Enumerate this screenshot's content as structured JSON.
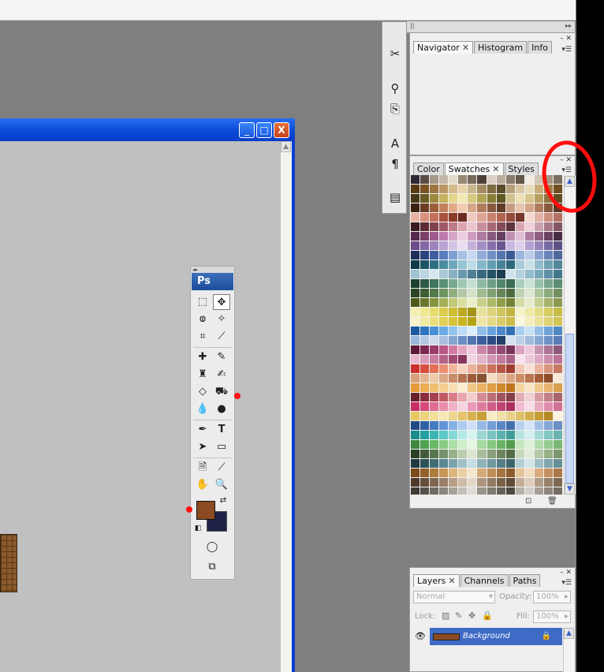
{
  "navigator_panel": {
    "tabs": [
      "Navigator",
      "Histogram",
      "Info"
    ]
  },
  "swatches_panel": {
    "tabs": [
      "Color",
      "Swatches",
      "Styles"
    ],
    "swatch_colors": [
      "#2e2832",
      "#5b4d46",
      "#a5998a",
      "#c3b9a8",
      "#e3dac8",
      "#9a8a75",
      "#786b5c",
      "#4e4238",
      "#dacfc2",
      "#bcae9d",
      "#8b7b6c",
      "#635849",
      "#f2ebe0",
      "#d0c4b2",
      "#a59684",
      "#7b6d5e",
      "#5a3a12",
      "#7a5424",
      "#9b7442",
      "#b99764",
      "#d4b98a",
      "#e8d2a8",
      "#cbb68c",
      "#a48c62",
      "#7e6a43",
      "#5b4c2c",
      "#b6a07a",
      "#d8c8a4",
      "#e9dcbd",
      "#c8ab78",
      "#9f7d49",
      "#704f21",
      "#433716",
      "#6a5a26",
      "#9c8a3f",
      "#c4b25d",
      "#e4d58a",
      "#f3e9b5",
      "#d7c97d",
      "#b1a453",
      "#887c36",
      "#5f5622",
      "#cfc18e",
      "#ebe0b6",
      "#d8c48d",
      "#b69e60",
      "#8d743d",
      "#614c22",
      "#3b2012",
      "#6b3d23",
      "#9c5e3a",
      "#c4825c",
      "#e1a984",
      "#f2cbb0",
      "#d6a487",
      "#b07a5c",
      "#875a40",
      "#5f3c28",
      "#c79b82",
      "#e6c4ad",
      "#d3a688",
      "#ae7c5d",
      "#86583d",
      "#5c3622",
      "#e8b3a3",
      "#d7907d",
      "#c46f5a",
      "#a9533f",
      "#8c3b2b",
      "#6d2a1f",
      "#f0c8be",
      "#dea293",
      "#c9806f",
      "#b26351",
      "#954a3a",
      "#77362a",
      "#f5d8cf",
      "#e3b2a5",
      "#cd8f80",
      "#b37062",
      "#3a1a1f",
      "#5d2b33",
      "#80414b",
      "#a05966",
      "#c07a86",
      "#dca3ad",
      "#eac5cb",
      "#c98e99",
      "#a66875",
      "#824a56",
      "#5f323c",
      "#d9a6b0",
      "#f0cfd6",
      "#caa1b0",
      "#a87a8b",
      "#845766",
      "#562a4a",
      "#7b3f6a",
      "#9e5a8c",
      "#bd7cac",
      "#d8a4c9",
      "#ecccdf",
      "#cf9dc0",
      "#ad7aa0",
      "#89597f",
      "#653f5e",
      "#c08fb1",
      "#dfbfd5",
      "#b07ea2",
      "#8e5e82",
      "#6b4262",
      "#4a2b44",
      "#6a4d8a",
      "#8367a5",
      "#9d84be",
      "#b9a3d3",
      "#d3c3e6",
      "#e7dcf2",
      "#c2b0db",
      "#a38fc5",
      "#8570ac",
      "#685591",
      "#c9b9e0",
      "#ddd0ec",
      "#b2a1d2",
      "#9585bb",
      "#776aa2",
      "#5c5287",
      "#1c2d5a",
      "#2b437e",
      "#3f5d9f",
      "#5a7cbd",
      "#7e9dd4",
      "#a8c0e6",
      "#c9d8f1",
      "#93abd9",
      "#7390c6",
      "#5574ae",
      "#3c5a92",
      "#9cb4de",
      "#bccdea",
      "#8aa1cf",
      "#6b84b7",
      "#4f689c",
      "#0f3a48",
      "#1c5466",
      "#2f6f84",
      "#4a8ca1",
      "#6da8bc",
      "#96c4d4",
      "#bcdbe6",
      "#84b7c9",
      "#639db1",
      "#468398",
      "#2c687d",
      "#a7cbd8",
      "#c8e0e8",
      "#90bccb",
      "#6fa1b3",
      "#528799",
      "#9ec3d3",
      "#b9d6e2",
      "#d5e7ee",
      "#a9c9d6",
      "#87b1c2",
      "#6899ad",
      "#4d8097",
      "#37687f",
      "#245266",
      "#1a3f50",
      "#cfe3eb",
      "#b3d2de",
      "#94bdcd",
      "#78a7ba",
      "#5d8fa4",
      "#43778c",
      "#1e4030",
      "#2d5a45",
      "#3f755c",
      "#589075",
      "#78ab91",
      "#9ec6b1",
      "#c3dfd1",
      "#8eb9a3",
      "#6d9f86",
      "#52866c",
      "#3a6d53",
      "#aacfbc",
      "#cbe3d6",
      "#98c1ab",
      "#79a78e",
      "#5c8d72",
      "#2a4424",
      "#3d5e34",
      "#53794a",
      "#6e9462",
      "#8fae80",
      "#b2c8a4",
      "#d2e2c7",
      "#a0bb91",
      "#819f72",
      "#668559",
      "#4c6b41",
      "#bed3b2",
      "#dbe8d2",
      "#abc59c",
      "#8dac7e",
      "#729264",
      "#4f5a1b",
      "#6a772a",
      "#86943c",
      "#a3b055",
      "#bfca77",
      "#d8e09f",
      "#eaefc7",
      "#c8d28a",
      "#abb865",
      "#909d49",
      "#758233",
      "#d3dba5",
      "#e6ebcb",
      "#c2ce8f",
      "#a5b46c",
      "#8a9a4f",
      "#f5f0b0",
      "#f0e88f",
      "#e8dc6c",
      "#ddcd4c",
      "#cfbd32",
      "#bba920",
      "#a39415",
      "#e9e29a",
      "#ddd37a",
      "#cfc45c",
      "#c1b442",
      "#f7f3c8",
      "#efe9a6",
      "#e4dc83",
      "#d6cc62",
      "#c7bc45",
      "#f9f3c9",
      "#f3eaa2",
      "#ebdf7c",
      "#e1d257",
      "#d6c437",
      "#c8b41f",
      "#b5a212",
      "#efe6a6",
      "#e5d985",
      "#d9cb66",
      "#ccbd4a",
      "#fbf8dc",
      "#f3edbc",
      "#e9e099",
      "#ded276",
      "#d2c455",
      "#1e5aa0",
      "#2d74bf",
      "#4690d6",
      "#68aae6",
      "#91c4f0",
      "#bddcf7",
      "#dbeefc",
      "#8dbde9",
      "#68a2dc",
      "#4a88ca",
      "#3170b3",
      "#a7cdef",
      "#c8e1f6",
      "#92bde7",
      "#70a2d6",
      "#5188c2",
      "#9bb6da",
      "#b4c8e4",
      "#cddaee",
      "#a8bfe0",
      "#86a5d1",
      "#6a8dc2",
      "#5075b1",
      "#3b5f9c",
      "#2c4c84",
      "#213d6c",
      "#d6e1f1",
      "#bdd0e9",
      "#a1bbde",
      "#87a6d2",
      "#6e91c5",
      "#577db7",
      "#5e1838",
      "#7e2650",
      "#9c3a69",
      "#b95684",
      "#d17aa2",
      "#e4a4c1",
      "#f2cadd",
      "#cb85a9",
      "#b0658d",
      "#944a73",
      "#7a345c",
      "#dca3c0",
      "#ecc7d9",
      "#c993b2",
      "#ac7497",
      "#8f597c",
      "#e6b6cc",
      "#d99ab6",
      "#ca7e9f",
      "#b86288",
      "#a24b72",
      "#89375d",
      "#f1d2e0",
      "#e3b4ca",
      "#d296b2",
      "#c07b9b",
      "#aa6285",
      "#f7e3ec",
      "#ebc7d7",
      "#dca9c2",
      "#cc8dac",
      "#ba7396",
      "#c9322e",
      "#d84f3e",
      "#e46f56",
      "#ed9174",
      "#f3b398",
      "#f8d3c0",
      "#ebb09a",
      "#dc8f79",
      "#cb705b",
      "#b75542",
      "#9f3e30",
      "#f4c7b4",
      "#fae1d6",
      "#eab39c",
      "#da957d",
      "#c87962",
      "#d8a078",
      "#e4b58f",
      "#eecaa8",
      "#dca886",
      "#c98c68",
      "#b5724f",
      "#9e5b3a",
      "#855330",
      "#f4dcc4",
      "#e9c2a2",
      "#dba783",
      "#cc8d66",
      "#bb744d",
      "#a65e38",
      "#8c4a28",
      "#f8e8d8",
      "#e59a3a",
      "#ecac52",
      "#f1be6e",
      "#f5cf8e",
      "#f8dfb0",
      "#fbecd0",
      "#f2c685",
      "#eab263",
      "#df9d44",
      "#d1892d",
      "#bf751b",
      "#f5d59f",
      "#f9e5c4",
      "#efc98c",
      "#e6b46d",
      "#db9f50",
      "#6a1f2c",
      "#8a2c3c",
      "#a8404f",
      "#c25a66",
      "#d87c85",
      "#e9a5aa",
      "#f4cbcd",
      "#d38d93",
      "#bc6e76",
      "#a2535c",
      "#883e48",
      "#e3aeb2",
      "#f0cfd1",
      "#d69ca1",
      "#c17f86",
      "#a9646c",
      "#c72f65",
      "#d54a7a",
      "#e16b93",
      "#ea8eac",
      "#f1b1c6",
      "#f7d2df",
      "#e99ab5",
      "#de7b9d",
      "#d05e86",
      "#c04470",
      "#ad2f5c",
      "#f2bcce",
      "#f8dce6",
      "#eaa9bf",
      "#df8daa",
      "#d17294",
      "#e8c85c",
      "#eed37a",
      "#f3de98",
      "#f7e9b7",
      "#eed58c",
      "#e4c46d",
      "#d8b150",
      "#ca9e37",
      "#f7ecc5",
      "#f0dfa6",
      "#e8d087",
      "#dec069",
      "#d3af4e",
      "#c59d36",
      "#b38a24",
      "#fbf5df",
      "#224a85",
      "#2f60a4",
      "#4379c0",
      "#5f94d6",
      "#84b0e6",
      "#aecbf1",
      "#cfe0f8",
      "#94b8e3",
      "#759fd4",
      "#5a86c3",
      "#4270ad",
      "#b9d0ef",
      "#d5e3f6",
      "#a2bfe6",
      "#86a7d6",
      "#6c8fc5",
      "#1a8a8a",
      "#24a0a0",
      "#3ab5b4",
      "#5ac8c6",
      "#84d9d6",
      "#b2e9e6",
      "#d6f4f2",
      "#9ad6d3",
      "#79c4c1",
      "#5ab1ae",
      "#3f9c99",
      "#b7e4e1",
      "#d5f0ee",
      "#a1d7d4",
      "#83c6c2",
      "#68b3af",
      "#3d8a3e",
      "#4fa250",
      "#68b866",
      "#86cc82",
      "#a9dea4",
      "#cdeec9",
      "#e5f7e2",
      "#a4d9a0",
      "#86c781",
      "#6ab365",
      "#519d4c",
      "#c2e6bd",
      "#dbf2d8",
      "#afdcaa",
      "#93ca8d",
      "#79b773",
      "#2a3f26",
      "#3f5a39",
      "#587650",
      "#74936a",
      "#96b08a",
      "#bccdae",
      "#dae6cf",
      "#a7bd99",
      "#889f79",
      "#6d855f",
      "#546b48",
      "#c8d8bc",
      "#e1ebd8",
      "#b3c8a4",
      "#98b088",
      "#7e976e",
      "#1e3a40",
      "#2c525a",
      "#406c75",
      "#5a8791",
      "#7aa3ac",
      "#a1c1c7",
      "#c6dde1",
      "#8eb2b8",
      "#6f979e",
      "#557d85",
      "#3d646c",
      "#b1cfd4",
      "#d2e6e9",
      "#9dbfc5",
      "#80a7ae",
      "#669097",
      "#7a4a18",
      "#946128",
      "#ae7b3c",
      "#c69756",
      "#dbb478",
      "#ecd0a2",
      "#f6e6cc",
      "#d5a978",
      "#bf8e59",
      "#a6743f",
      "#8c5c2a",
      "#e6c49a",
      "#f2dcbf",
      "#daab7e",
      "#c49062",
      "#ab7648",
      "#4d3a2a",
      "#654e3a",
      "#7f664f",
      "#9a8068",
      "#b59d86",
      "#cfbba7",
      "#e5d8ca",
      "#ad967e",
      "#917a63",
      "#776149",
      "#5e4a35",
      "#c3ae99",
      "#ddccbb",
      "#b29c85",
      "#98816a",
      "#7e6852",
      "#3f3a34",
      "#57514a",
      "#706962",
      "#8b847c",
      "#a8a198",
      "#c5beb6",
      "#e0dbd5",
      "#9b948b",
      "#807970",
      "#665f57",
      "#4e4841",
      "#b8b1a8",
      "#d3cec7",
      "#a79f96",
      "#8d857c",
      "#746c63",
      "#24b5b0",
      "#3cc2bd",
      "#5ccfca",
      "#80dbd6",
      "#a8e7e3",
      "#cff3f0",
      "#f0c54a",
      "#e8a838",
      "#d88a2c",
      "#c46d22",
      "#ac531a",
      "#2b8ec6",
      "#4aa5d6",
      "#6dbbe3",
      "#96d0ee",
      "#c0e4f7"
    ]
  },
  "layers_panel": {
    "tabs": [
      "Layers",
      "Channels",
      "Paths"
    ],
    "blend_mode": "Normal",
    "opacity_label": "Opacity:",
    "opacity_value": "100%",
    "lock_label": "Lock:",
    "fill_label": "Fill:",
    "fill_value": "100%",
    "layer_name": "Background"
  },
  "toolbox": {
    "logo": "Ps",
    "foreground_color": "#8b4a22",
    "background_color": "#1e2045"
  },
  "document_window": {
    "title": "",
    "controls": [
      "_",
      "□",
      "X"
    ]
  },
  "annotations": {
    "highlight_color": "#ff0d0d"
  }
}
